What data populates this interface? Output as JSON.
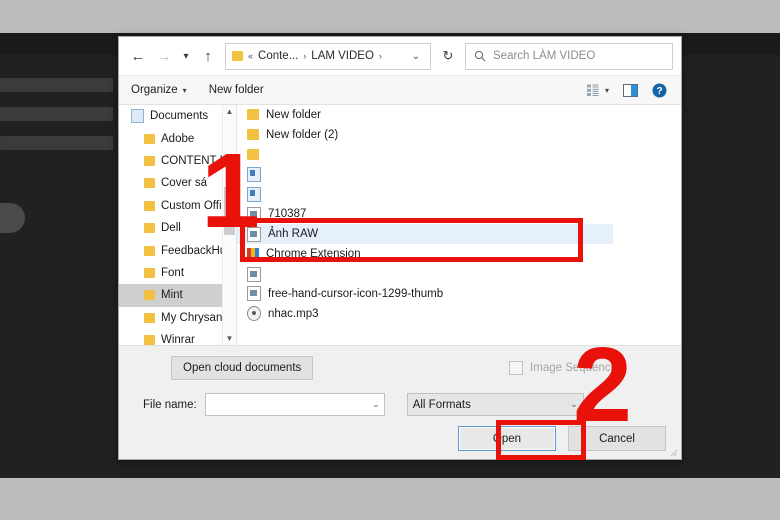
{
  "dialog": {
    "nav": {
      "back_icon": "arrow-left-icon",
      "forward_icon": "arrow-right-icon",
      "recent_icon": "chevron-down-icon",
      "up_icon": "arrow-up-icon",
      "refresh_icon": "refresh-icon",
      "address_dropdown_icon": "chevron-down-icon"
    },
    "breadcrumbs": [
      "Conte...",
      "LÀM VIDEO",
      ""
    ],
    "breadcrumb_separator": "›",
    "breadcrumb_prefix": "«",
    "search": {
      "placeholder": "Search LÀM VIDEO",
      "icon": "search-icon"
    },
    "toolbar": {
      "organize_label": "Organize",
      "organize_caret": "▾",
      "new_folder_label": "New folder",
      "view_icon": "view-layout-icon",
      "view_caret": "▾",
      "preview_pane_icon": "preview-pane-icon",
      "help_icon": "help-icon",
      "help_glyph": "?"
    },
    "tree": {
      "scroll_up_icon": "chevron-up-icon",
      "scroll_down_icon": "chevron-down-icon",
      "items": [
        {
          "label": "Documents",
          "icon": "documents-icon",
          "level": "root",
          "selected": false
        },
        {
          "label": "Adobe",
          "icon": "folder-icon",
          "level": "child",
          "selected": false
        },
        {
          "label": "CONTENT RỒ",
          "icon": "folder-icon",
          "level": "child",
          "selected": false
        },
        {
          "label": "Cover sá",
          "icon": "folder-icon",
          "level": "child",
          "selected": false
        },
        {
          "label": "Custom Office",
          "icon": "folder-icon",
          "level": "child",
          "selected": false
        },
        {
          "label": "Dell",
          "icon": "folder-icon",
          "level": "child",
          "selected": false
        },
        {
          "label": "FeedbackHub",
          "icon": "folder-icon",
          "level": "child",
          "selected": false
        },
        {
          "label": "Font",
          "icon": "folder-icon",
          "level": "child",
          "selected": false
        },
        {
          "label": "Mint",
          "icon": "folder-icon",
          "level": "child",
          "selected": true
        },
        {
          "label": "My Chrysanth",
          "icon": "folder-icon",
          "level": "child",
          "selected": false
        },
        {
          "label": "Winrar",
          "icon": "folder-icon",
          "level": "child",
          "selected": false
        }
      ]
    },
    "files": [
      {
        "label": "New folder",
        "icon": "folder-icon",
        "selected": false
      },
      {
        "label": "New folder (2)",
        "icon": "folder-icon",
        "selected": false
      },
      {
        "label": "",
        "icon": "folder-icon",
        "selected": false
      },
      {
        "label": "",
        "icon": "psd-file-icon",
        "selected": false
      },
      {
        "label": "",
        "icon": "psd-file-icon",
        "selected": false
      },
      {
        "label": "710387",
        "icon": "image-file-icon",
        "selected": false
      },
      {
        "label": "Ảnh RAW",
        "icon": "image-file-icon",
        "selected": true
      },
      {
        "label": "Chrome Extension",
        "icon": "puzzle-icon",
        "selected": false
      },
      {
        "label": "",
        "icon": "image-file-icon",
        "selected": false
      },
      {
        "label": "free-hand-cursor-icon-1299-thumb",
        "icon": "image-file-icon",
        "selected": false
      },
      {
        "label": "nhac.mp3",
        "icon": "audio-file-icon",
        "selected": false
      }
    ],
    "footer": {
      "open_cloud_label": "Open cloud documents",
      "image_sequence_label": "Image Sequence",
      "image_sequence_checked": false,
      "file_name_label": "File name:",
      "file_name_value": "",
      "file_name_dropdown_icon": "chevron-down-icon",
      "format_value": "All Formats",
      "format_dropdown_icon": "chevron-down-icon",
      "open_label": "Open",
      "cancel_label": "Cancel",
      "resize_grip_icon": "resize-grip-icon"
    }
  },
  "annotations": {
    "step_one": "1",
    "step_two": "2",
    "highlight_color": "#e8120b"
  }
}
